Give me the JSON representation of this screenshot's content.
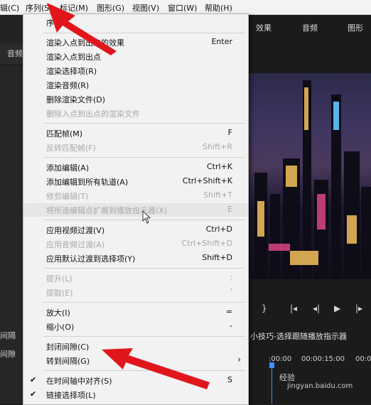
{
  "menubar": {
    "items": [
      {
        "label": "辑(C)"
      },
      {
        "label": "序列(S)"
      },
      {
        "label": "标记(M)"
      },
      {
        "label": "图形(G)"
      },
      {
        "label": "视图(V)"
      },
      {
        "label": "窗口(W)"
      },
      {
        "label": "帮助(H)"
      }
    ]
  },
  "workspace_tabs": [
    "效果",
    "音频",
    "图形"
  ],
  "left_panel": {
    "label": "音频"
  },
  "dropdown": {
    "items": [
      {
        "label": "序列",
        "shortcut": "",
        "disabled": false
      },
      {
        "label": "渲染入点到出点的效果",
        "shortcut": "Enter",
        "disabled": false
      },
      {
        "label": "渲染入点到出点",
        "shortcut": "",
        "disabled": false
      },
      {
        "label": "渲染选择项(R)",
        "shortcut": "",
        "disabled": false
      },
      {
        "label": "渲染音频(R)",
        "shortcut": "",
        "disabled": false
      },
      {
        "label": "删除渲染文件(D)",
        "shortcut": "",
        "disabled": false
      },
      {
        "label": "删除入点到出点的渲染文件",
        "shortcut": "",
        "disabled": true
      },
      {
        "label": "匹配帧(M)",
        "shortcut": "F",
        "disabled": false
      },
      {
        "label": "反转匹配帧(F)",
        "shortcut": "Shift+R",
        "disabled": true
      },
      {
        "label": "添加编辑(A)",
        "shortcut": "Ctrl+K",
        "disabled": false
      },
      {
        "label": "添加编辑到所有轨道(A)",
        "shortcut": "Ctrl+Shift+K",
        "disabled": false
      },
      {
        "label": "修剪编辑(T)",
        "shortcut": "Shift+T",
        "disabled": true
      },
      {
        "label": "将所选编辑点扩展到播放指示器(X)",
        "shortcut": "E",
        "disabled": true
      },
      {
        "label": "应用视频过渡(V)",
        "shortcut": "Ctrl+D",
        "disabled": false
      },
      {
        "label": "应用音频过渡(A)",
        "shortcut": "Ctrl+Shift+D",
        "disabled": true
      },
      {
        "label": "应用默认过渡到选择项(Y)",
        "shortcut": "Shift+D",
        "disabled": false
      },
      {
        "label": "提升(L)",
        "shortcut": ";",
        "disabled": true
      },
      {
        "label": "提取(E)",
        "shortcut": "'",
        "disabled": true
      },
      {
        "label": "放大(I)",
        "shortcut": "=",
        "disabled": false
      },
      {
        "label": "缩小(O)",
        "shortcut": "-",
        "disabled": false
      },
      {
        "label": "封闭间隙(C)",
        "shortcut": "",
        "disabled": false
      },
      {
        "label": "转到间隔(G)",
        "shortcut": "",
        "disabled": false,
        "submenu": true
      },
      {
        "label": "在时间轴中对齐(S)",
        "shortcut": "S",
        "disabled": false,
        "checked": true
      },
      {
        "label": "链接选择项(L)",
        "shortcut": "",
        "disabled": false,
        "checked": true
      }
    ]
  },
  "sequence_title": "小技巧-选择跟随播放指示器",
  "timecodes": [
    ":00:00",
    "00:00:15:00",
    "00:0"
  ],
  "timeline_left": {
    "label1": "间隔",
    "label2": "间隙"
  },
  "watermark": {
    "line1": "经验",
    "line2": "jingyan.baidu.com"
  },
  "colors": {
    "accent_red": "#e0161c",
    "playhead_blue": "#3f8fff"
  }
}
